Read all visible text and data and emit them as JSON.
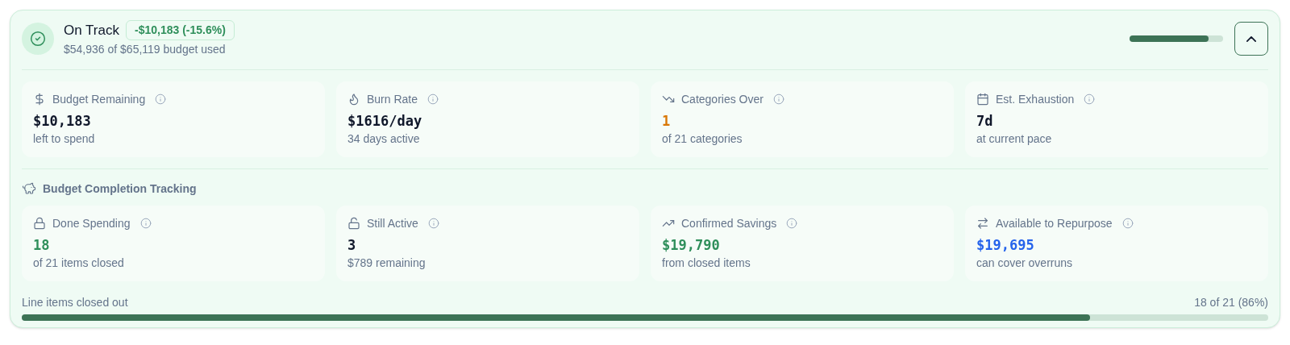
{
  "status": {
    "title": "On Track",
    "delta": "-$10,183 (-15.6%)",
    "subtitle": "$54,936 of $65,119 budget used",
    "level": 0.844,
    "expanded": true
  },
  "stats": [
    {
      "label": "Budget Remaining",
      "value": "$10,183",
      "color": "#0f172a",
      "note": "left to spend"
    },
    {
      "label": "Burn Rate",
      "value": "$1616/day",
      "color": "#0f172a",
      "note": "34 days active"
    },
    {
      "label": "Categories Over",
      "value": "1",
      "color": "#d97706",
      "note": "of 21 categories"
    },
    {
      "label": "Est. Exhaustion",
      "value": "7d",
      "color": "#0f172a",
      "note": "at current pace"
    }
  ],
  "completion": {
    "title": "Budget Completion Tracking",
    "stats": [
      {
        "label": "Done Spending",
        "value": "18",
        "color": "#2f8f5b",
        "note": "of 21 items closed"
      },
      {
        "label": "Still Active",
        "value": "3",
        "color": "#0f172a",
        "note": "$789 remaining"
      },
      {
        "label": "Confirmed Savings",
        "value": "$19,790",
        "color": "#2f8f5b",
        "note": "from closed items"
      },
      {
        "label": "Available to Repurpose",
        "value": "$19,695",
        "color": "#2563eb",
        "note": "can cover overruns"
      }
    ],
    "progress_label": "Line items closed out",
    "progress_reading": "18 of 21 (86%)",
    "level": 0.857
  }
}
